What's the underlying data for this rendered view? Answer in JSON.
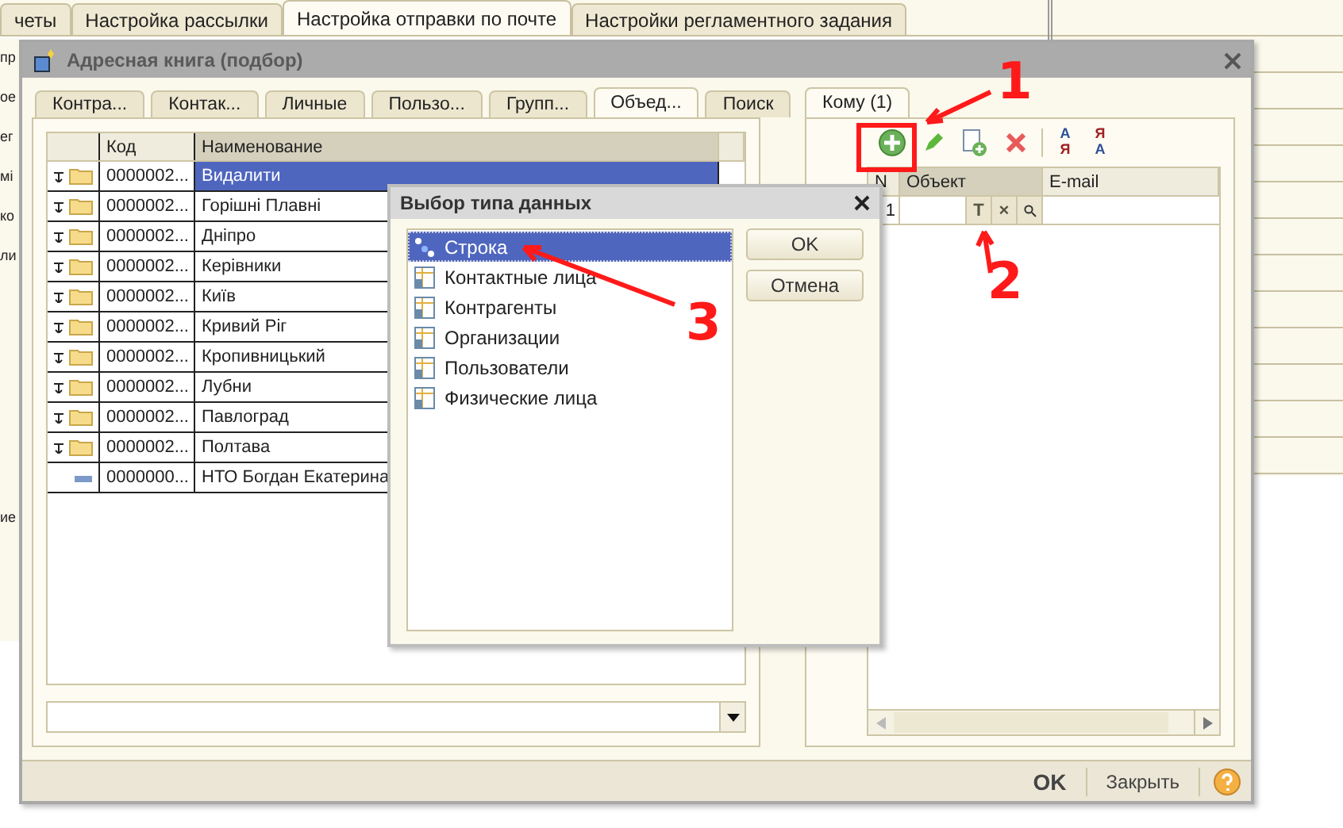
{
  "background": {
    "tabs": [
      {
        "label": "четы",
        "selected": false
      },
      {
        "label": "Настройка рассылки",
        "selected": false
      },
      {
        "label": "Настройка отправки по почте",
        "selected": true
      },
      {
        "label": "Настройки регламентного задания",
        "selected": false
      }
    ],
    "side_fragments": [
      "пр",
      "ое",
      "ег",
      "мі",
      "ко",
      "ли",
      "ие"
    ]
  },
  "dialog": {
    "title": "Адресная книга (подбор)",
    "tabs": [
      {
        "label": "Контра...",
        "selected": false
      },
      {
        "label": "Контак...",
        "selected": false
      },
      {
        "label": "Личные",
        "selected": false
      },
      {
        "label": "Пользо...",
        "selected": false
      },
      {
        "label": "Групп...",
        "selected": false
      },
      {
        "label": "Объед...",
        "selected": true
      },
      {
        "label": "Поиск",
        "selected": false
      }
    ],
    "table": {
      "columns": [
        "Код",
        "Наименование"
      ],
      "rows": [
        {
          "kind": "group",
          "code": "0000002...",
          "name": "Видалити",
          "selected": true
        },
        {
          "kind": "group",
          "code": "0000002...",
          "name": "Горішні Плавні",
          "selected": false
        },
        {
          "kind": "group",
          "code": "0000002...",
          "name": "Дніпро",
          "selected": false
        },
        {
          "kind": "group",
          "code": "0000002...",
          "name": "Керівники",
          "selected": false
        },
        {
          "kind": "group",
          "code": "0000002...",
          "name": "Київ",
          "selected": false
        },
        {
          "kind": "group",
          "code": "0000002...",
          "name": "Кривий Ріг",
          "selected": false
        },
        {
          "kind": "group",
          "code": "0000002...",
          "name": "Кропивницький",
          "selected": false
        },
        {
          "kind": "group",
          "code": "0000002...",
          "name": "Лубни",
          "selected": false
        },
        {
          "kind": "group",
          "code": "0000002...",
          "name": "Павлоград",
          "selected": false
        },
        {
          "kind": "group",
          "code": "0000002...",
          "name": "Полтава",
          "selected": false
        },
        {
          "kind": "item",
          "code": "0000000...",
          "name": "НТО Богдан Екатерина",
          "selected": false
        }
      ]
    },
    "recipients": {
      "tab": {
        "label": "Кому (1)",
        "selected": true
      },
      "sort_buttons": [
        {
          "top": "А",
          "bottom": "Я"
        },
        {
          "top": "Я",
          "bottom": "А"
        }
      ],
      "columns": [
        "N",
        "Объект",
        "E-mail"
      ],
      "rows": [
        {
          "n": "1",
          "cell_buttons": [
            "T",
            "×"
          ]
        }
      ]
    },
    "footer": {
      "ok": "OK",
      "close": "Закрыть"
    }
  },
  "type_dialog": {
    "title": "Выбор типа данных",
    "items": [
      {
        "kind": "string",
        "label": "Строка",
        "selected": true
      },
      {
        "kind": "catalog",
        "label": "Контактные лица",
        "selected": false
      },
      {
        "kind": "catalog",
        "label": "Контрагенты",
        "selected": false
      },
      {
        "kind": "catalog",
        "label": "Организации",
        "selected": false
      },
      {
        "kind": "catalog",
        "label": "Пользователи",
        "selected": false
      },
      {
        "kind": "catalog",
        "label": "Физические лица",
        "selected": false
      }
    ],
    "buttons": [
      "OK",
      "Отмена"
    ]
  },
  "annotations": [
    {
      "label": "1"
    },
    {
      "label": "2"
    },
    {
      "label": "3"
    }
  ]
}
